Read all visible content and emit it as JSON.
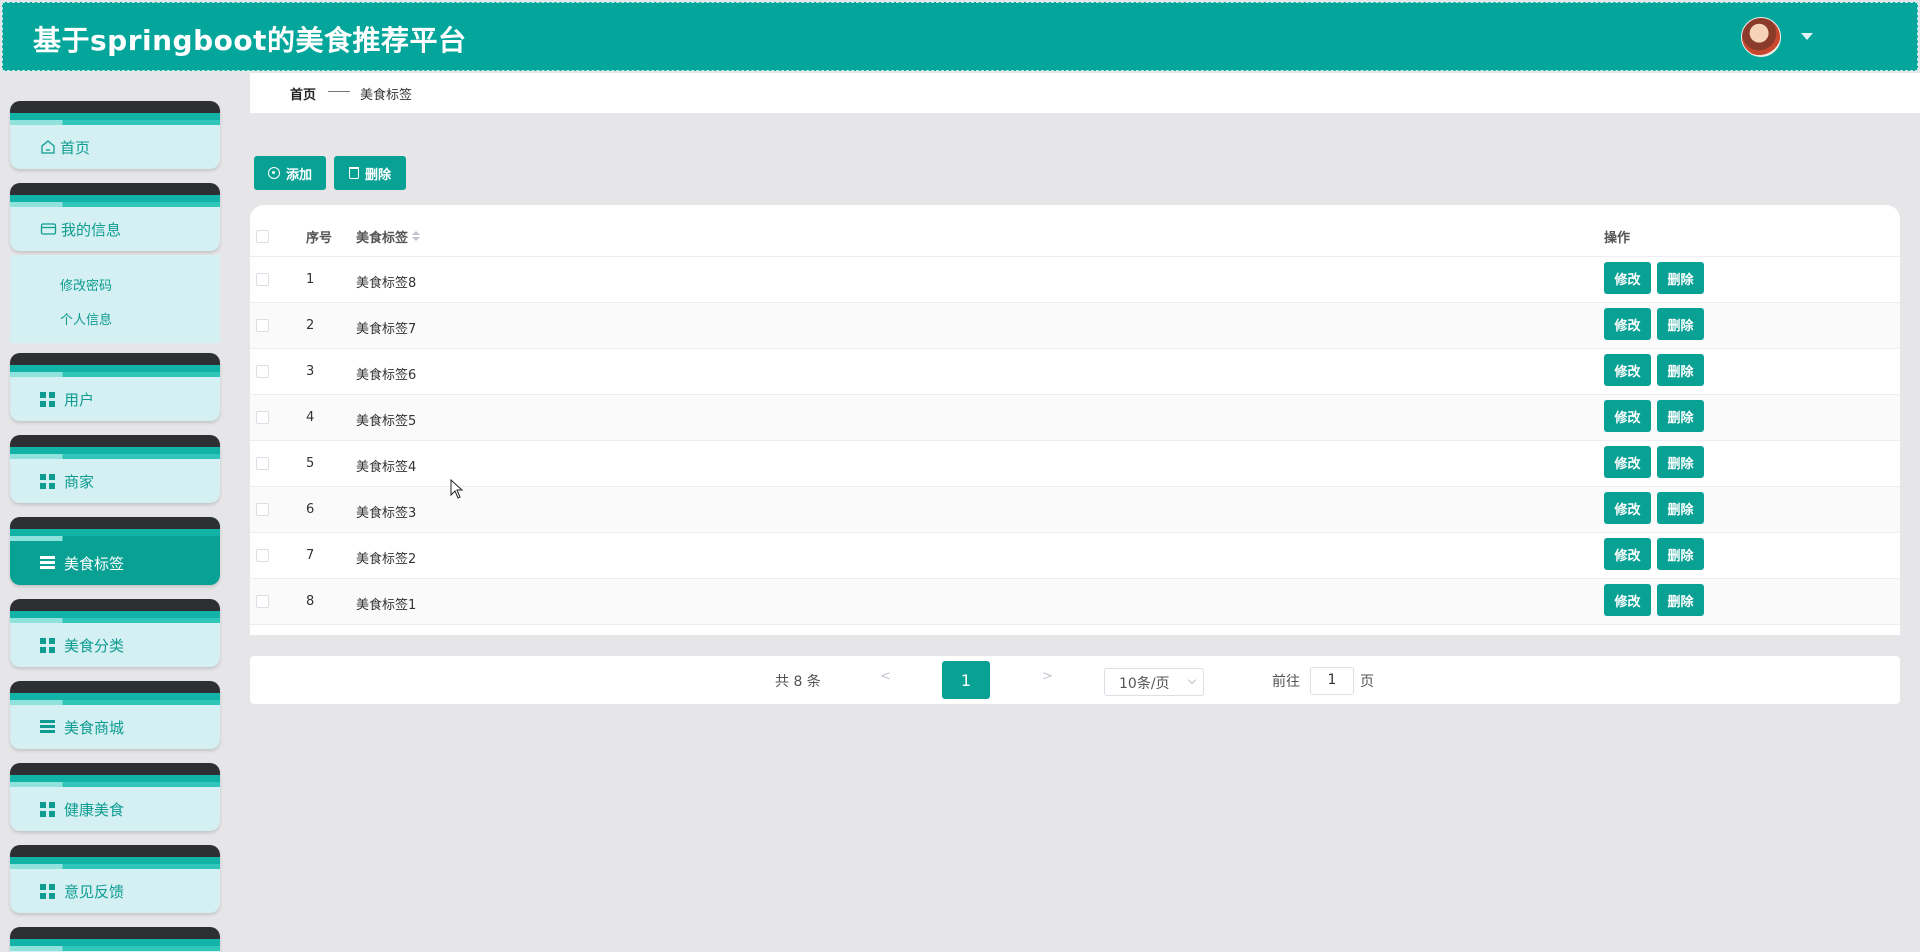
{
  "app": {
    "title": "基于springboot的美食推荐平台"
  },
  "header": {
    "avatar_icon": "avatar-icon",
    "caret_icon": "caret-down-icon"
  },
  "sidebar": {
    "items": [
      {
        "label": "首页",
        "icon": "home-icon"
      },
      {
        "label": "我的信息",
        "icon": "wallet-icon"
      },
      {
        "label": "用户",
        "icon": "grid-icon"
      },
      {
        "label": "商家",
        "icon": "grid-icon"
      },
      {
        "label": "美食标签",
        "icon": "list-icon",
        "active": true
      },
      {
        "label": "美食分类",
        "icon": "grid-icon"
      },
      {
        "label": "美食商城",
        "icon": "list-icon"
      },
      {
        "label": "健康美食",
        "icon": "grid-icon"
      },
      {
        "label": "意见反馈",
        "icon": "grid-icon"
      }
    ],
    "submenu": [
      {
        "label": "修改密码"
      },
      {
        "label": "个人信息"
      }
    ]
  },
  "breadcrumb": {
    "home": "首页",
    "current": "美食标签"
  },
  "toolbar": {
    "add_label": "添加",
    "delete_label": "删除"
  },
  "table": {
    "headers": {
      "index": "序号",
      "tag": "美食标签",
      "actions": "操作"
    },
    "rows": [
      {
        "index": "1",
        "tag": "美食标签8"
      },
      {
        "index": "2",
        "tag": "美食标签7"
      },
      {
        "index": "3",
        "tag": "美食标签6"
      },
      {
        "index": "4",
        "tag": "美食标签5"
      },
      {
        "index": "5",
        "tag": "美食标签4"
      },
      {
        "index": "6",
        "tag": "美食标签3"
      },
      {
        "index": "7",
        "tag": "美食标签2"
      },
      {
        "index": "8",
        "tag": "美食标签1"
      }
    ],
    "edit_label": "修改",
    "delete_label": "删除"
  },
  "pagination": {
    "total_label": "共 8 条",
    "prev": "<",
    "next": ">",
    "current_page": "1",
    "page_size": "10条/页",
    "goto_label": "前往",
    "goto_value": "1",
    "page_unit": "页"
  },
  "colors": {
    "primary": "#0aa195",
    "header_bg": "#04a59a",
    "sidebar_card": "#d5f0f3"
  }
}
